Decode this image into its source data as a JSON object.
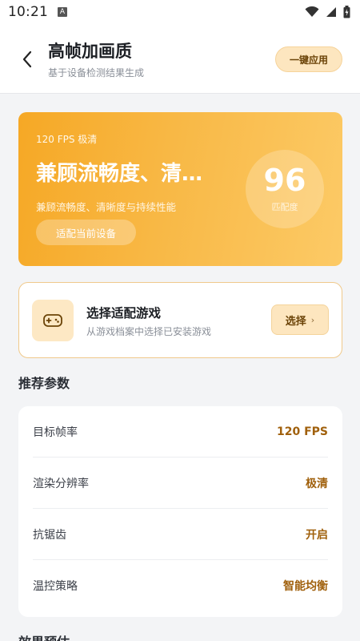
{
  "status_bar": {
    "time": "10:21",
    "notif_badge": "A"
  },
  "header": {
    "title": "高帧加画质",
    "subtitle": "基于设备检测结果生成",
    "apply_label": "一键应用"
  },
  "hero": {
    "tag": "120 FPS 极清",
    "title": "兼顾流畅度、清…",
    "desc": "兼顾流畅度、清晰度与持续性能",
    "chip_label": "适配当前设备",
    "score": "96",
    "score_label": "匹配度"
  },
  "game_select": {
    "title": "选择适配游戏",
    "desc": "从游戏档案中选择已安装游戏",
    "button_label": "选择",
    "button_chevron": "›"
  },
  "params": {
    "section_title": "推荐参数",
    "rows": [
      {
        "label": "目标帧率",
        "value": "120 FPS"
      },
      {
        "label": "渲染分辨率",
        "value": "极清"
      },
      {
        "label": "抗锯齿",
        "value": "开启"
      },
      {
        "label": "温控策略",
        "value": "智能均衡"
      }
    ]
  },
  "preview": {
    "section_title": "效果预估"
  },
  "colors": {
    "accent": "#f6a825",
    "value_text": "#a0600c",
    "button_bg": "#fde6bf"
  },
  "icons": [
    "back-arrow-icon",
    "gamepad-icon",
    "wifi-icon",
    "signal-icon",
    "battery-icon"
  ]
}
